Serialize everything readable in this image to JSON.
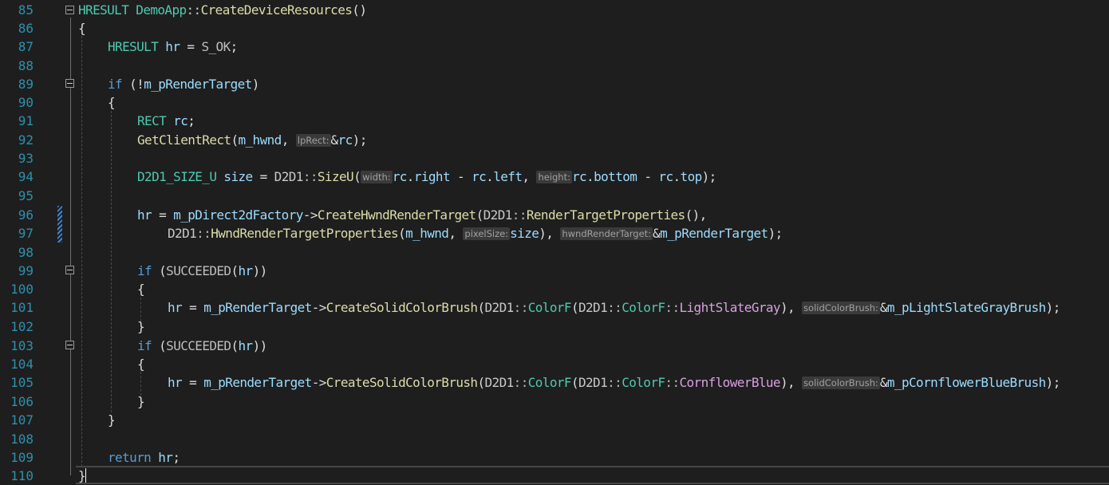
{
  "editor": {
    "lines": [
      {
        "n": "85"
      },
      {
        "n": "86"
      },
      {
        "n": "87"
      },
      {
        "n": "88"
      },
      {
        "n": "89"
      },
      {
        "n": "90"
      },
      {
        "n": "91"
      },
      {
        "n": "92"
      },
      {
        "n": "93"
      },
      {
        "n": "94"
      },
      {
        "n": "95"
      },
      {
        "n": "96"
      },
      {
        "n": "97"
      },
      {
        "n": "98"
      },
      {
        "n": "99"
      },
      {
        "n": "100"
      },
      {
        "n": "101"
      },
      {
        "n": "102"
      },
      {
        "n": "103"
      },
      {
        "n": "104"
      },
      {
        "n": "105"
      },
      {
        "n": "106"
      },
      {
        "n": "107"
      },
      {
        "n": "108"
      },
      {
        "n": "109"
      },
      {
        "n": "110"
      }
    ],
    "hints": {
      "lpRect": "lpRect:",
      "width": "width:",
      "height": "height:",
      "pixelSize": "pixelSize:",
      "hwndRenderTarget": "hwndRenderTarget:",
      "solidColorBrush": "solidColorBrush:"
    },
    "colors": {
      "background": "#1e1e1e",
      "line_number": "#2b91af",
      "keyword": "#569cd6",
      "type": "#4ec9b0",
      "function": "#dcdcaa",
      "variable": "#9cdcfe",
      "change_marker": "#3a87d6"
    }
  }
}
